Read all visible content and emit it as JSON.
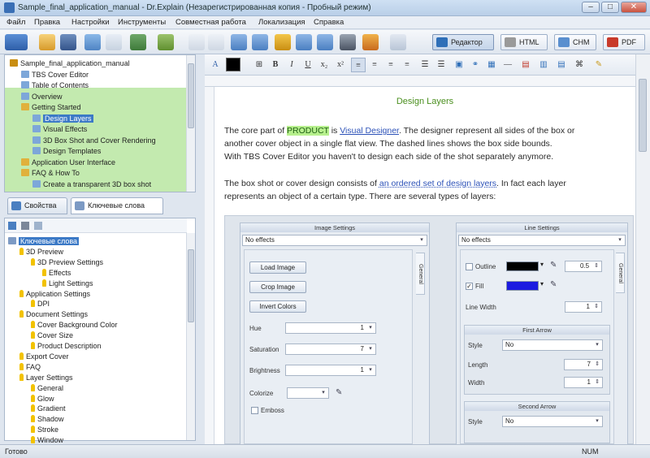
{
  "window": {
    "title": "Sample_final_application_manual - Dr.Explain (Незарегистрированная копия - Пробный режим)"
  },
  "menu": [
    "Файл",
    "Правка",
    "Настройки",
    "Инструменты",
    "Совместная работа",
    "Локализация",
    "Справка"
  ],
  "view_buttons": [
    {
      "label": "Редактор",
      "icon": "editor-icon",
      "color": "#2f6fb8",
      "active": true
    },
    {
      "label": "HTML",
      "icon": "html-icon",
      "color": "#9a9a9a"
    },
    {
      "label": "CHM",
      "icon": "chm-icon",
      "color": "#5a8fcf"
    },
    {
      "label": "PDF",
      "icon": "pdf-icon",
      "color": "#c83a2a"
    }
  ],
  "tree": {
    "items": [
      {
        "label": "Sample_final_application_manual",
        "indent": 0,
        "icon": "book-icon"
      },
      {
        "label": "TBS Cover Editor",
        "indent": 1,
        "icon": "page-icon"
      },
      {
        "label": "Table of Contents",
        "indent": 1,
        "icon": "page-icon"
      },
      {
        "label": "Overview",
        "indent": 1,
        "icon": "page-icon"
      },
      {
        "label": "Getting Started",
        "indent": 1,
        "icon": "folder-icon"
      },
      {
        "label": "Design Layers",
        "indent": 2,
        "icon": "page-icon",
        "selected": true
      },
      {
        "label": "Visual Effects",
        "indent": 2,
        "icon": "page-icon"
      },
      {
        "label": "3D Box Shot and Cover Rendering",
        "indent": 2,
        "icon": "page-icon"
      },
      {
        "label": "Design Templates",
        "indent": 2,
        "icon": "page-icon"
      },
      {
        "label": "Application User Interface",
        "indent": 1,
        "icon": "folder-icon"
      },
      {
        "label": "FAQ & How To",
        "indent": 1,
        "icon": "folder-icon"
      },
      {
        "label": "Create a transparent 3D box shot",
        "indent": 2,
        "icon": "page-icon"
      }
    ]
  },
  "panel_tabs": [
    {
      "label": "Свойства",
      "icon": "properties-icon"
    },
    {
      "label": "Ключевые слова",
      "icon": "keywords-icon",
      "active": true
    }
  ],
  "keywords": {
    "items": [
      {
        "label": "Ключевые слова",
        "indent": 0,
        "root": true
      },
      {
        "label": "3D Preview",
        "indent": 1
      },
      {
        "label": "3D Preview Settings",
        "indent": 2
      },
      {
        "label": "Effects",
        "indent": 3
      },
      {
        "label": "Light Settings",
        "indent": 3
      },
      {
        "label": "Application Settings",
        "indent": 1
      },
      {
        "label": "DPI",
        "indent": 2
      },
      {
        "label": "Document Settings",
        "indent": 1
      },
      {
        "label": "Cover Background Color",
        "indent": 2
      },
      {
        "label": "Cover Size",
        "indent": 2
      },
      {
        "label": "Product Description",
        "indent": 2
      },
      {
        "label": "Export Cover",
        "indent": 1
      },
      {
        "label": "FAQ",
        "indent": 1
      },
      {
        "label": "Layer Settings",
        "indent": 1
      },
      {
        "label": "General",
        "indent": 2
      },
      {
        "label": "Glow",
        "indent": 2
      },
      {
        "label": "Gradient",
        "indent": 2
      },
      {
        "label": "Shadow",
        "indent": 2
      },
      {
        "label": "Stroke",
        "indent": 2
      },
      {
        "label": "Window",
        "indent": 2
      }
    ]
  },
  "document": {
    "heading": "Design Layers",
    "p1a": "The core part of ",
    "p1_product": "PRODUCT",
    "p1b": " is ",
    "p1_link": "Visual Designer",
    "p1c": ". The designer represent all sides of the box or",
    "p1_line2": "another cover object in a single flat view. The dashed lines shows the box side bounds.",
    "p1_line3": "With TBS Cover Editor you haven't to design each side of the shot separately anymore.",
    "p2a": "The box shot or cover design consists of ",
    "p2_link": "an ordered set of design layers",
    "p2b": ". In fact each layer",
    "p2_line2": "represents an object of a certain type. There are several types of layers:"
  },
  "image_settings": {
    "title": "Image Settings",
    "effect": "No effects",
    "load_image": "Load Image",
    "crop_image": "Crop Image",
    "invert_colors": "Invert Colors",
    "hue_label": "Hue",
    "hue_value": "1",
    "saturation_label": "Saturation",
    "saturation_value": "7",
    "brightness_label": "Brightness",
    "brightness_value": "1",
    "colorize_label": "Colorize",
    "emboss_label": "Emboss",
    "side_tab": "General"
  },
  "line_settings": {
    "title": "Line Settings",
    "effect": "No effects",
    "outline_label": "Outline",
    "outline_color": "#000000",
    "outline_value": "0.5",
    "fill_label": "Fill",
    "fill_color": "#1c1ce0",
    "line_width_label": "Line Width",
    "line_width_value": "1",
    "first_arrow_title": "First Arrow",
    "style_label": "Style",
    "style_value": "No",
    "length_label": "Length",
    "length_value": "7",
    "width_label": "Width",
    "width_value": "1",
    "second_arrow_title": "Second Arrow",
    "style2_value": "No",
    "side_tab": "General"
  },
  "status": {
    "left": "Готово",
    "right": "NUM"
  }
}
